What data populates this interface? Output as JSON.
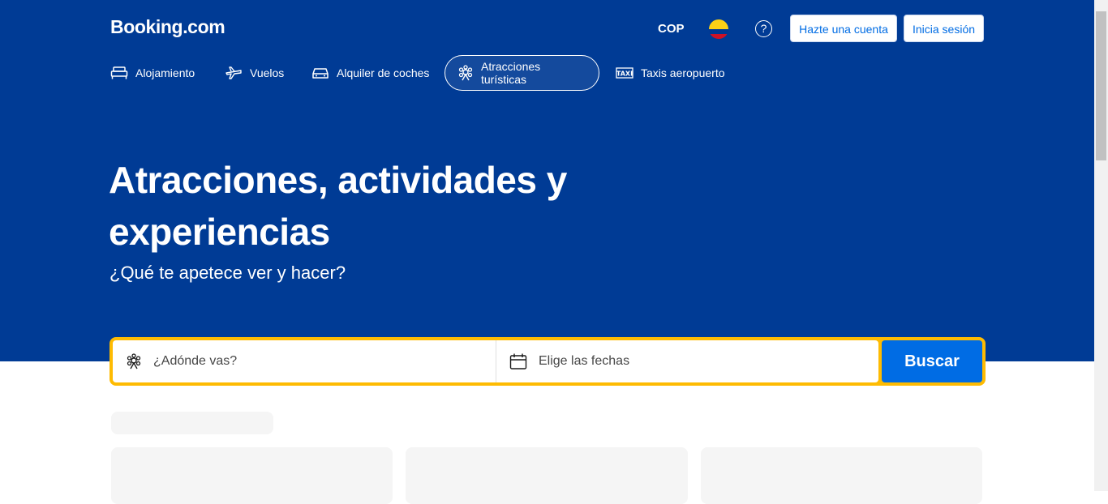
{
  "header": {
    "logo": "Booking.com",
    "currency": "COP",
    "help_icon": "help-icon",
    "register_label": "Hazte una cuenta",
    "login_label": "Inicia sesión"
  },
  "nav": {
    "items": [
      {
        "label": "Alojamiento",
        "icon": "bed-icon"
      },
      {
        "label": "Vuelos",
        "icon": "plane-icon"
      },
      {
        "label": "Alquiler de coches",
        "icon": "car-icon"
      },
      {
        "label": "Atracciones turísticas",
        "icon": "attractions-icon",
        "active": true
      },
      {
        "label": "Taxis aeropuerto",
        "icon": "taxi-icon"
      }
    ]
  },
  "hero": {
    "title": "Atracciones, actividades y experiencias",
    "subtitle": "¿Qué te apetece ver y hacer?"
  },
  "search": {
    "destination_placeholder": "¿Adónde vas?",
    "dates_placeholder": "Elige las fechas",
    "button_label": "Buscar"
  },
  "colors": {
    "brand_blue": "#003b95",
    "action_blue": "#006ce4",
    "search_border": "#febb02"
  }
}
